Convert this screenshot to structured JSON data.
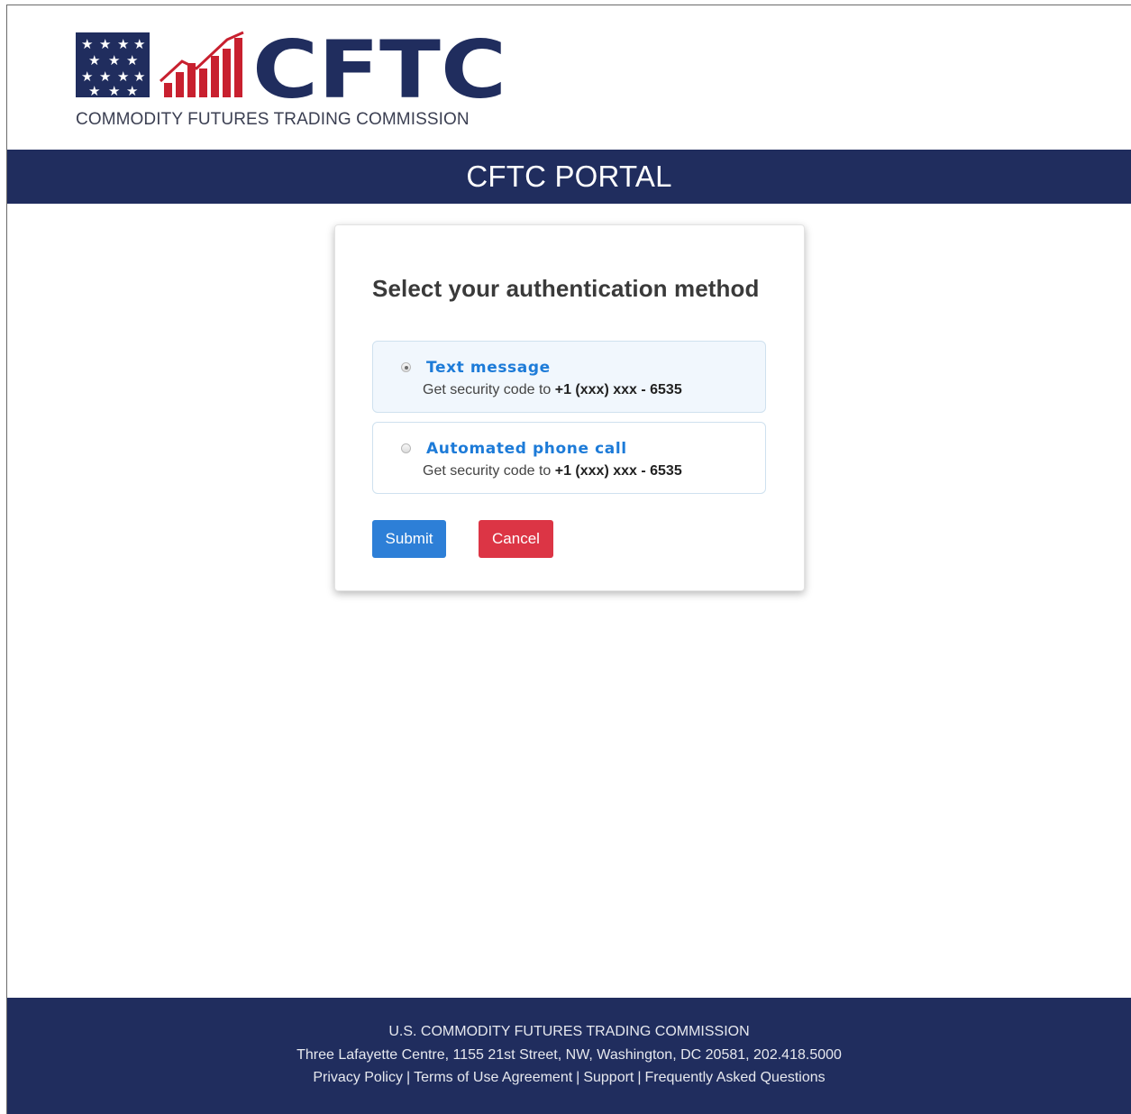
{
  "header": {
    "logo_text": "CFTC",
    "logo_subtitle": "COMMODITY FUTURES TRADING COMMISSION",
    "banner_title": "CFTC PORTAL"
  },
  "card": {
    "title": "Select your authentication method",
    "options": [
      {
        "label": "Text message",
        "desc_prefix": "Get security code to ",
        "phone": "+1 (xxx) xxx - 6535",
        "selected": true
      },
      {
        "label": "Automated phone call",
        "desc_prefix": "Get security code to ",
        "phone": "+1 (xxx) xxx - 6535",
        "selected": false
      }
    ],
    "submit_label": "Submit",
    "cancel_label": "Cancel"
  },
  "footer": {
    "org": "U.S. COMMODITY FUTURES TRADING COMMISSION",
    "address": "Three Lafayette Centre, 1155 21st Street, NW, Washington, DC 20581, 202.418.5000",
    "links": [
      "Privacy Policy",
      "Terms of Use Agreement",
      "Support",
      "Frequently Asked Questions"
    ],
    "separator": "|"
  },
  "colors": {
    "navy": "#202d5e",
    "logo_red": "#c8202f",
    "option_label": "#1d7bd8",
    "submit": "#2d7fd7",
    "cancel": "#dc3545"
  },
  "icons": [
    "star-flag-logo-icon",
    "bar-chart-logo-icon",
    "radio-icon"
  ]
}
